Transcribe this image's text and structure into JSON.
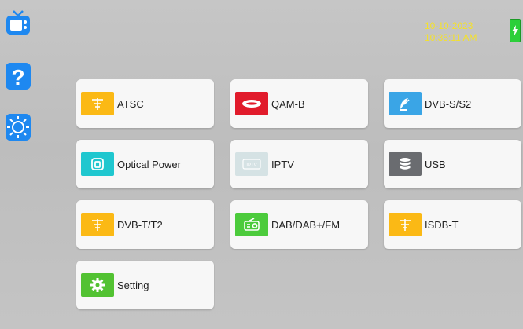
{
  "clock": {
    "date": "10-10-2023",
    "time": "10:35:11 AM"
  },
  "menu": [
    {
      "label": "ATSC",
      "icon": "antenna-icon",
      "color": "#fbb915"
    },
    {
      "label": "QAM-B",
      "icon": "cable-icon",
      "color": "#e11b2b"
    },
    {
      "label": "DVB-S/S2",
      "icon": "satellite-dish-icon",
      "color": "#3aa5e6"
    },
    {
      "label": "Optical Power",
      "icon": "optical-port-icon",
      "color": "#1fc7cf"
    },
    {
      "label": "IPTV",
      "icon": "iptv-icon",
      "color": "#d5e2e4"
    },
    {
      "label": "USB",
      "icon": "database-icon",
      "color": "#6a6c70"
    },
    {
      "label": "DVB-T/T2",
      "icon": "antenna-icon",
      "color": "#fbb915"
    },
    {
      "label": "DAB/DAB+/FM",
      "icon": "radio-icon",
      "color": "#4ccb3c"
    },
    {
      "label": "ISDB-T",
      "icon": "antenna-icon",
      "color": "#fbb915"
    },
    {
      "label": "Setting",
      "icon": "gear-icon",
      "color": "#52c232"
    }
  ]
}
